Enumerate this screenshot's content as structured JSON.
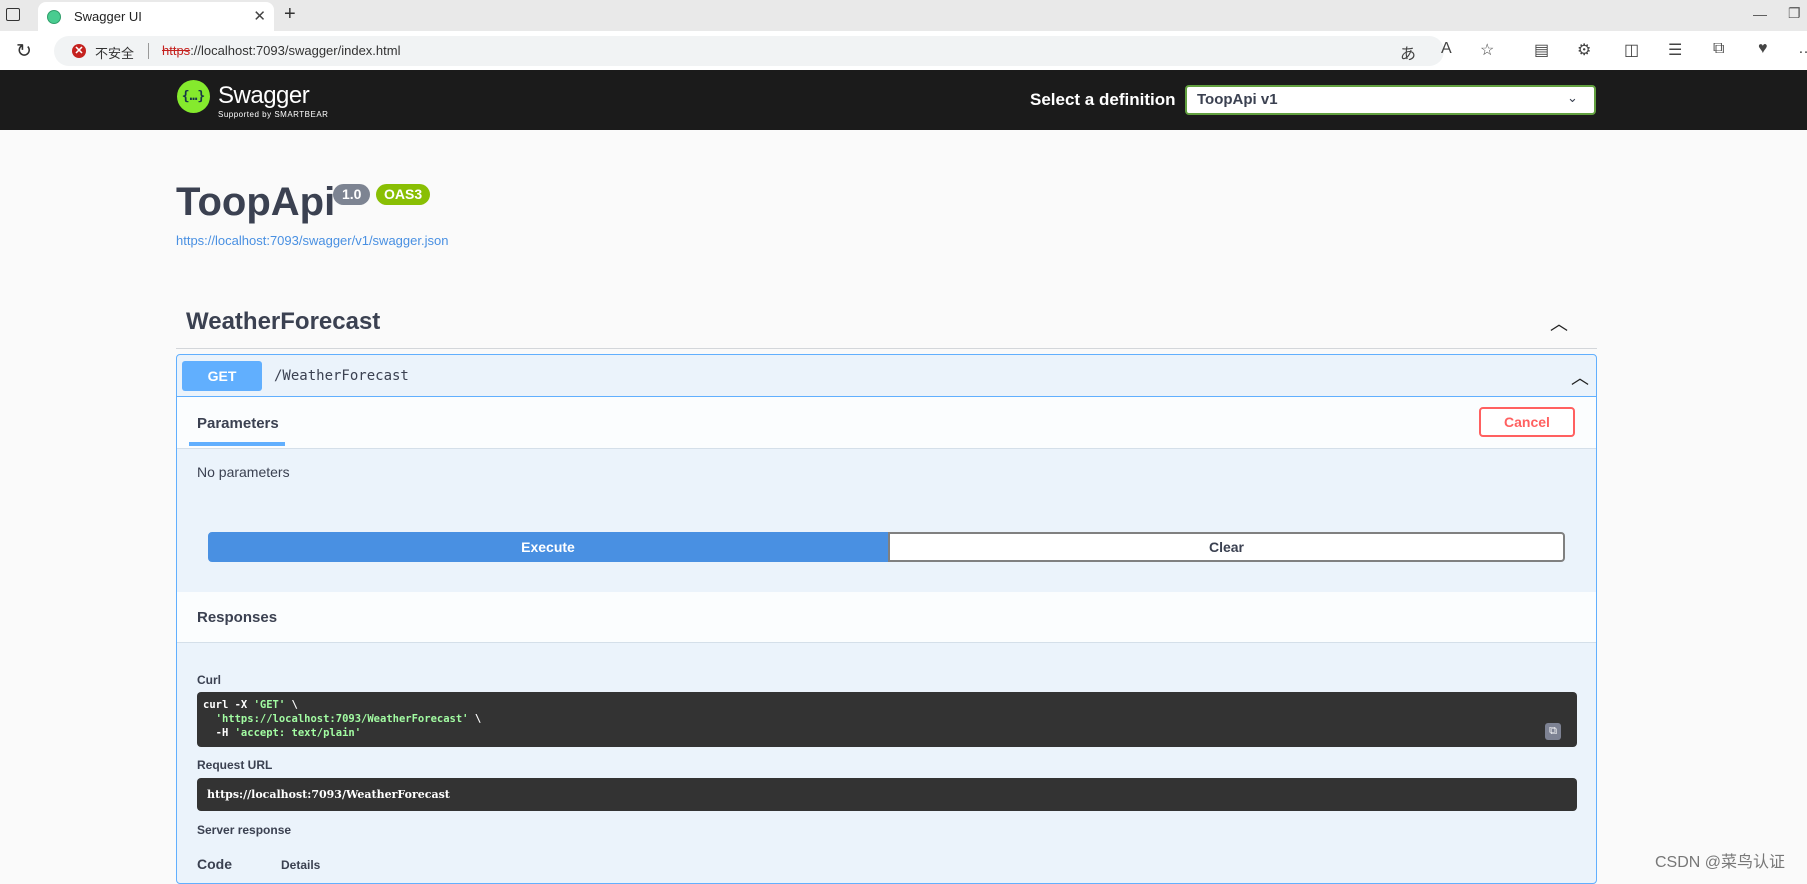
{
  "browser": {
    "tab_title": "Swagger UI",
    "tab_close": "✕",
    "new_tab": "+",
    "security_label": "不安全",
    "url_protocol": "https",
    "url_rest": "://localhost:7093/swagger/index.html",
    "icons": [
      "read-aloud-icon",
      "favorites-star-icon",
      "extensions-icon",
      "split-screen-icon",
      "favorites-list-icon",
      "collections-icon",
      "performance-icon"
    ]
  },
  "topbar": {
    "logo_text": "Swagger",
    "logo_sub": "Supported by SMARTBEAR",
    "definition_label": "Select a definition",
    "definition_value": "ToopApi v1"
  },
  "info": {
    "title": "ToopApi",
    "version": "1.0",
    "oas": "OAS3",
    "spec_url": "https://localhost:7093/swagger/v1/swagger.json"
  },
  "tag": {
    "name": "WeatherForecast"
  },
  "operation": {
    "method": "GET",
    "path": "/WeatherForecast",
    "parameters_tab": "Parameters",
    "cancel_label": "Cancel",
    "no_parameters": "No parameters",
    "execute_label": "Execute",
    "clear_label": "Clear",
    "responses_title": "Responses",
    "curl_label": "Curl",
    "curl_lines": {
      "l1_pre": "curl -X ",
      "l1_str": "'GET'",
      "l1_post": " \\",
      "l2_str": "  'https://localhost:7093/WeatherForecast'",
      "l2_post": " \\",
      "l3_pre": "  -H ",
      "l3_str": "'accept: text/plain'"
    },
    "request_url_label": "Request URL",
    "request_url": "https://localhost:7093/WeatherForecast",
    "server_response_label": "Server response",
    "code_col": "Code",
    "details_col": "Details"
  },
  "watermark": "CSDN @菜鸟认证"
}
